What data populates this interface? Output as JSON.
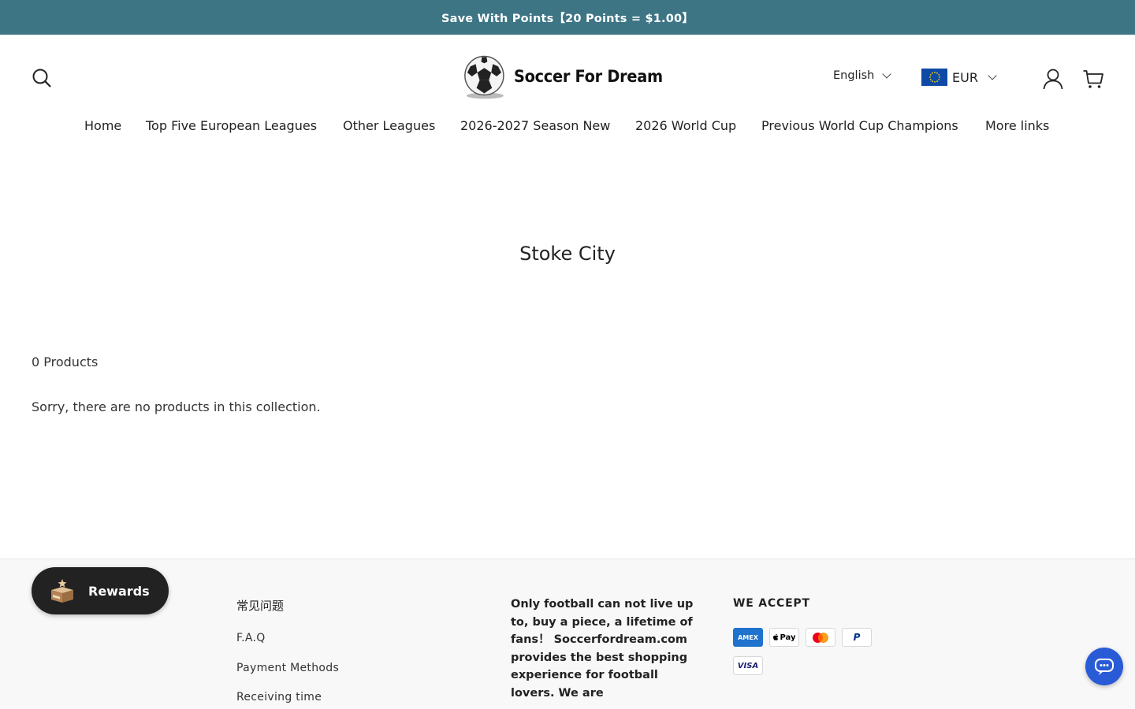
{
  "announcement": {
    "text": "Save With Points【20 Points = $1.00】"
  },
  "header": {
    "logo_text": "Soccer For Dream",
    "language": "English",
    "currency": "EUR"
  },
  "nav": {
    "items": [
      {
        "label": "Home"
      },
      {
        "label": "Top Five European Leagues"
      },
      {
        "label": "Other Leagues"
      },
      {
        "label": "2026-2027 Season New"
      },
      {
        "label": "2026 World Cup"
      },
      {
        "label": "Previous World Cup Champions"
      },
      {
        "label": "More links"
      }
    ]
  },
  "main": {
    "title": "Stoke City",
    "product_count": "0 Products",
    "empty_message": "Sorry, there are no products in this collection."
  },
  "footer": {
    "links_heading": "常见问题",
    "links": [
      {
        "label": "F.A.Q"
      },
      {
        "label": "Payment Methods"
      },
      {
        "label": "Receiving time"
      }
    ],
    "about_text": "Only football can not live up to, buy a piece, a lifetime of fans！ Soccerfordream.com provides the best shopping experience for football lovers. We are",
    "accept_heading": "WE ACCEPT",
    "payment_methods": [
      {
        "label": "AMEX"
      },
      {
        "label": "Pay"
      },
      {
        "label": ""
      },
      {
        "label": "P"
      },
      {
        "label": "VISA"
      }
    ]
  },
  "widgets": {
    "rewards_label": "Rewards"
  },
  "colors": {
    "announcement_bg": "#3d7585",
    "rewards_bg": "#222222",
    "chat_bg": "#2a5bd7"
  }
}
